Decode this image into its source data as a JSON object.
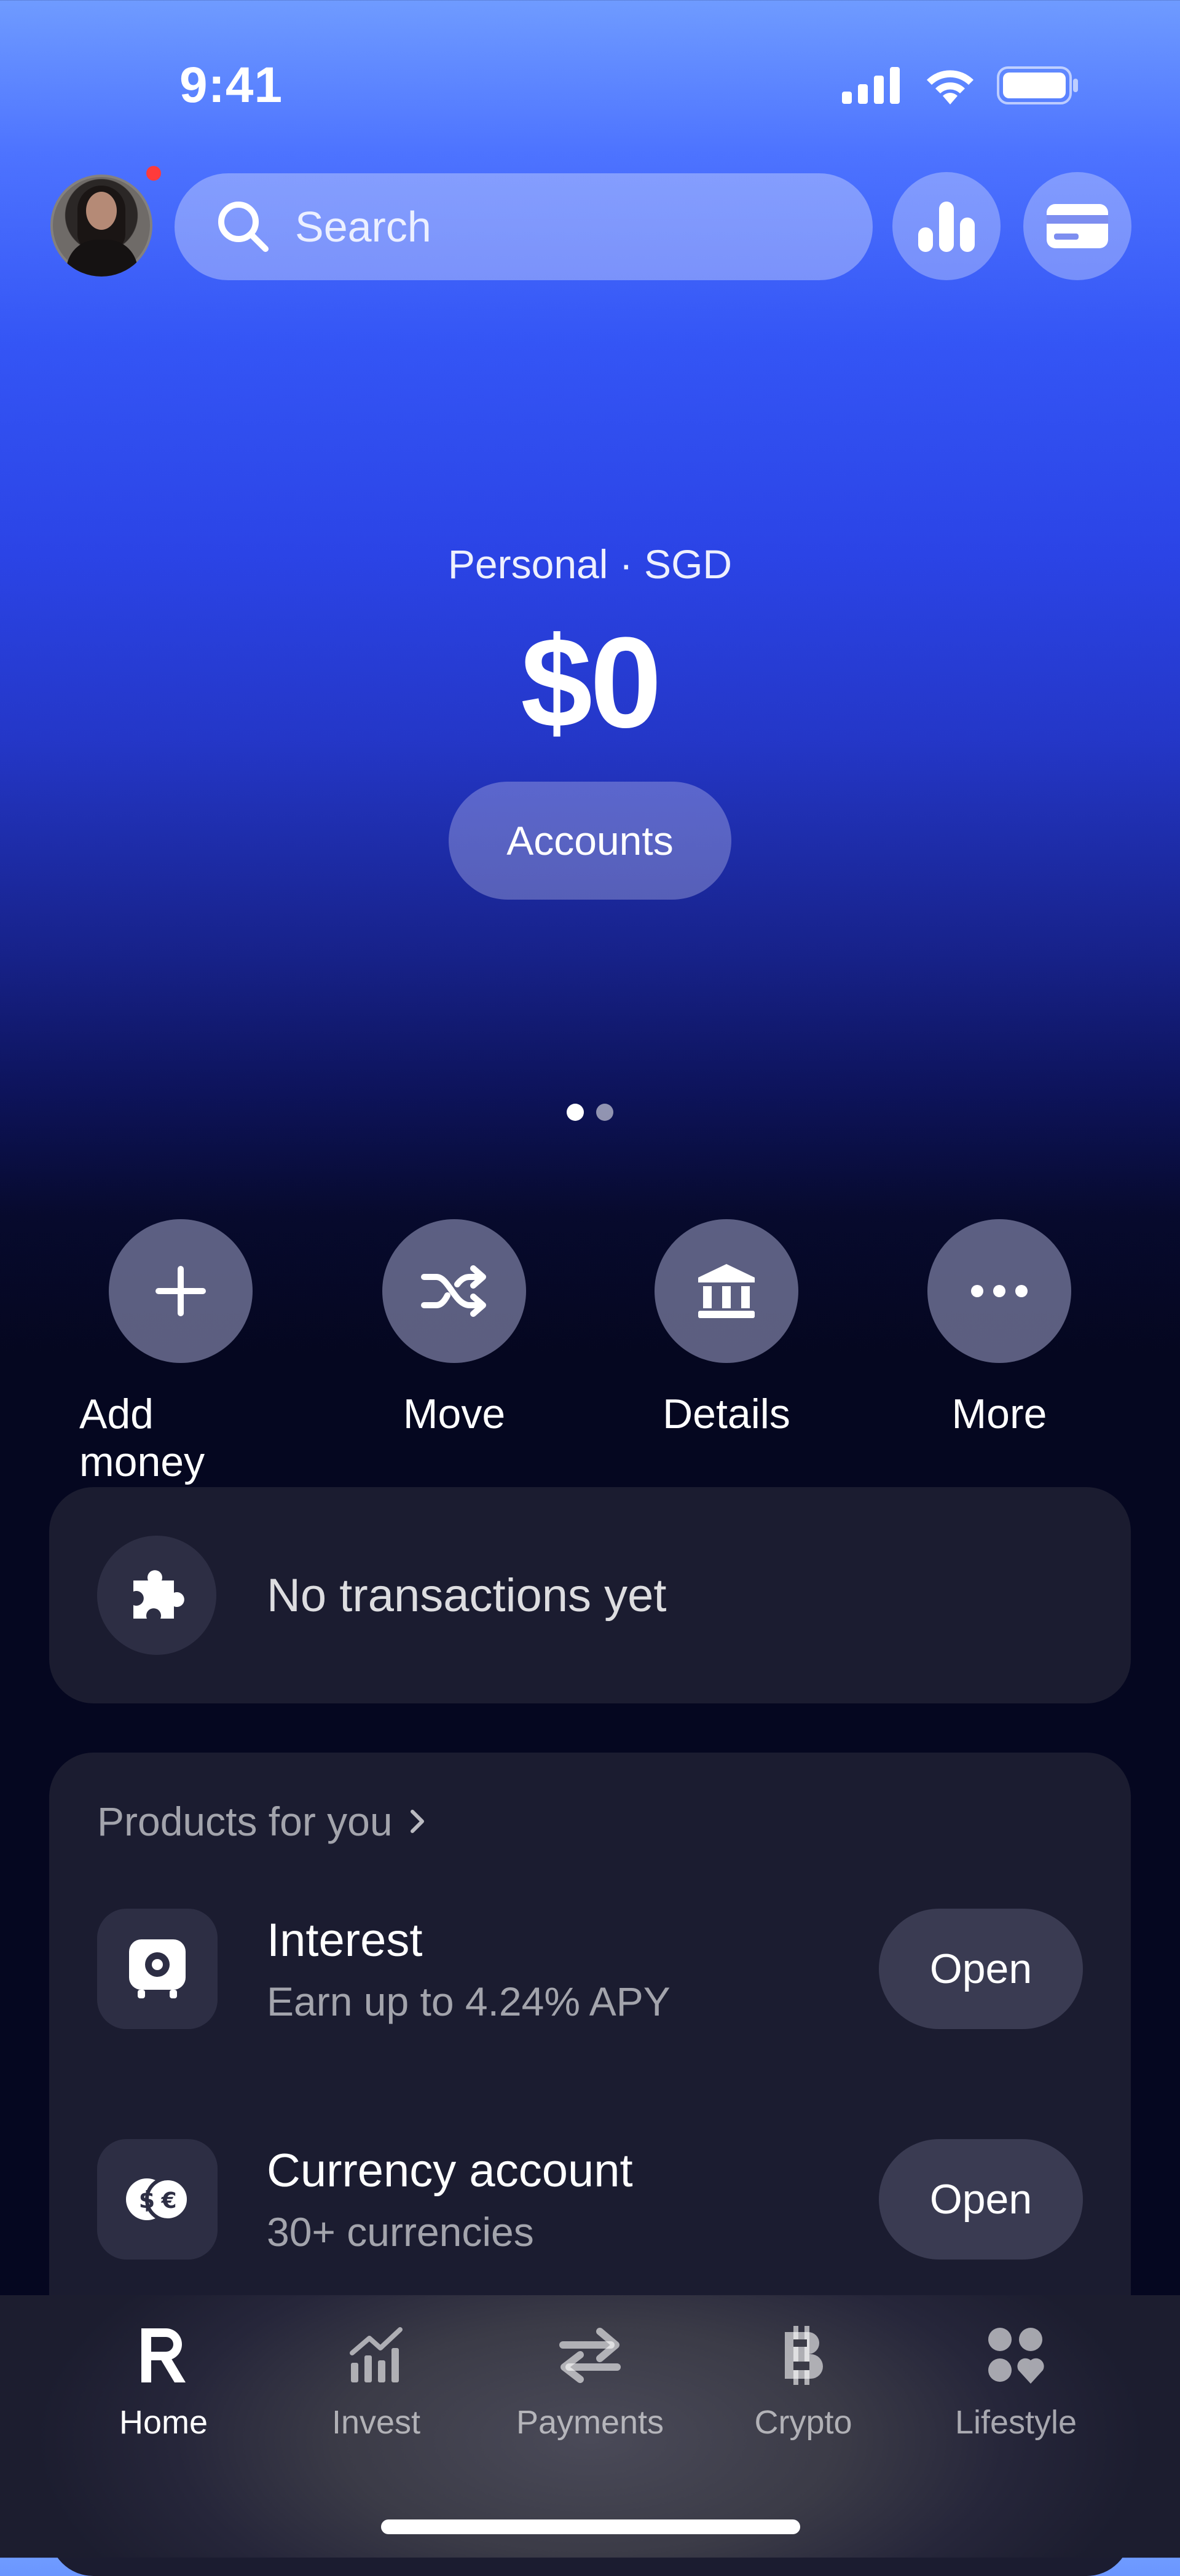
{
  "status_bar": {
    "time": "9:41"
  },
  "search": {
    "placeholder": "Search"
  },
  "balance": {
    "account_label": "Personal · SGD",
    "amount": "$0",
    "accounts_button": "Accounts",
    "page_index": 1,
    "page_count": 2
  },
  "actions": [
    {
      "label": "Add money",
      "icon": "plus-icon"
    },
    {
      "label": "Move",
      "icon": "shuffle-icon"
    },
    {
      "label": "Details",
      "icon": "bank-icon"
    },
    {
      "label": "More",
      "icon": "ellipsis-icon"
    }
  ],
  "transactions": {
    "empty_text": "No transactions yet",
    "icon": "puzzle-icon"
  },
  "products": {
    "heading": "Products for you",
    "items": [
      {
        "title": "Interest",
        "subtitle": "Earn up to 4.24% APY",
        "button": "Open",
        "icon": "safe-icon"
      },
      {
        "title": "Currency account",
        "subtitle": "30+ currencies",
        "button": "Open",
        "icon": "currency-exchange-icon"
      }
    ]
  },
  "tabbar": {
    "items": [
      {
        "label": "Home",
        "icon": "revolut-logo-icon",
        "active": true
      },
      {
        "label": "Invest",
        "icon": "chart-icon",
        "active": false
      },
      {
        "label": "Payments",
        "icon": "transfer-icon",
        "active": false
      },
      {
        "label": "Crypto",
        "icon": "bitcoin-icon",
        "active": false
      },
      {
        "label": "Lifestyle",
        "icon": "lifestyle-icon",
        "active": false
      }
    ]
  },
  "colors": {
    "accent_blue": "#2b44e6",
    "card_bg": "#1b1c30",
    "notification": "#ff3b3b"
  }
}
